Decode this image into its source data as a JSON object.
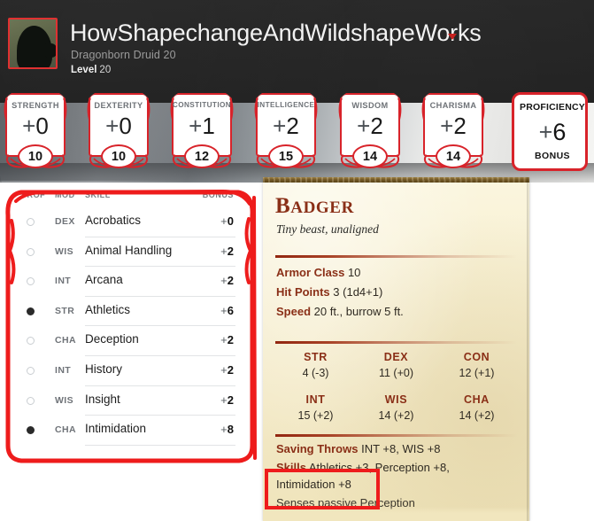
{
  "header": {
    "avatar_name": "character-portrait",
    "title": "HowShapechangeAndWildshapeWorks",
    "caret_icon": "chevron-down-icon",
    "subtitle": "Dragonborn  Druid 20",
    "level_label": "Level",
    "level_value": "20"
  },
  "abilities": [
    {
      "name": "STRENGTH",
      "sign": "+",
      "mod": "0",
      "score": "10"
    },
    {
      "name": "DEXTERITY",
      "sign": "+",
      "mod": "0",
      "score": "10"
    },
    {
      "name": "CONSTITUTION",
      "sign": "+",
      "mod": "1",
      "score": "12"
    },
    {
      "name": "INTELLIGENCE",
      "sign": "+",
      "mod": "2",
      "score": "15"
    },
    {
      "name": "WISDOM",
      "sign": "+",
      "mod": "2",
      "score": "14"
    },
    {
      "name": "CHARISMA",
      "sign": "+",
      "mod": "2",
      "score": "14"
    }
  ],
  "proficiency": {
    "title": "PROFICIENCY",
    "sign": "+",
    "value": "6",
    "subtitle": "BONUS"
  },
  "skills_panel": {
    "columns": {
      "prof": "PROF",
      "mod": "MOD",
      "skill": "SKILL",
      "bonus": "BONUS"
    },
    "rows": [
      {
        "proficient": false,
        "mod": "DEX",
        "skill": "Acrobatics",
        "sign": "+",
        "bonus": "0"
      },
      {
        "proficient": false,
        "mod": "WIS",
        "skill": "Animal Handling",
        "sign": "+",
        "bonus": "2"
      },
      {
        "proficient": false,
        "mod": "INT",
        "skill": "Arcana",
        "sign": "+",
        "bonus": "2"
      },
      {
        "proficient": true,
        "mod": "STR",
        "skill": "Athletics",
        "sign": "+",
        "bonus": "6"
      },
      {
        "proficient": false,
        "mod": "CHA",
        "skill": "Deception",
        "sign": "+",
        "bonus": "2"
      },
      {
        "proficient": false,
        "mod": "INT",
        "skill": "History",
        "sign": "+",
        "bonus": "2"
      },
      {
        "proficient": false,
        "mod": "WIS",
        "skill": "Insight",
        "sign": "+",
        "bonus": "2"
      },
      {
        "proficient": true,
        "mod": "CHA",
        "skill": "Intimidation",
        "sign": "+",
        "bonus": "8"
      }
    ]
  },
  "statblock": {
    "name": "Badger",
    "meta": "Tiny beast, unaligned",
    "armor_class_label": "Armor Class",
    "armor_class_value": "10",
    "hit_points_label": "Hit Points",
    "hit_points_value": "3  (1d4+1)",
    "speed_label": "Speed",
    "speed_value": "20 ft., burrow 5 ft.",
    "scores": [
      {
        "key": "STR",
        "value": "4 (-3)"
      },
      {
        "key": "DEX",
        "value": "11 (+0)"
      },
      {
        "key": "CON",
        "value": "12 (+1)"
      },
      {
        "key": "INT",
        "value": "15 (+2)"
      },
      {
        "key": "WIS",
        "value": "14 (+2)"
      },
      {
        "key": "CHA",
        "value": "14 (+2)"
      }
    ],
    "saving_throws_label": "Saving Throws",
    "saving_throws_value": "INT +8, WIS +8",
    "skills_label": "Skills",
    "skills_value": "Athletics +3, Perception +8,",
    "skills_value_line2": "Intimidation +8",
    "cut_line": "Senses passive Perception"
  },
  "colors": {
    "accent_red": "#d8232a",
    "annotation_red": "#ee1c1c",
    "statblock_heading": "#8a2f17",
    "header_bg": "#242424",
    "parchment": "#f4ecc9"
  }
}
